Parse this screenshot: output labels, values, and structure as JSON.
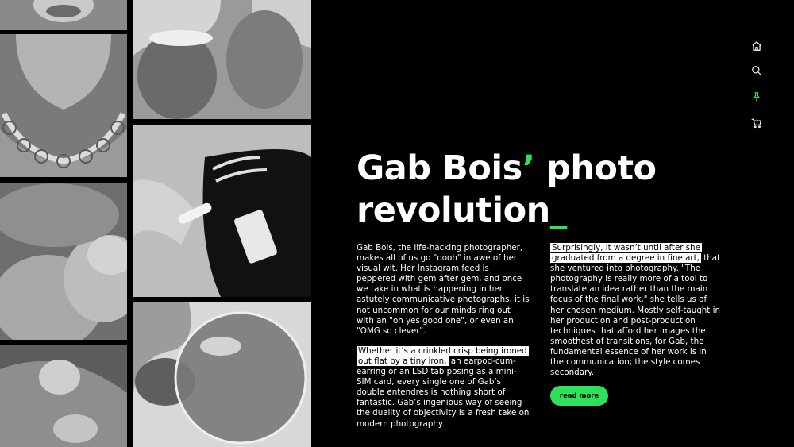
{
  "article": {
    "title_main": "Gab Bois",
    "title_apos": "’",
    "title_rest": " photo revolution",
    "title_cursor": "_",
    "col1": {
      "p1": "Gab Bois, the life-hacking photographer, makes all of us go \"oooh\" in awe of her visual wit. Her Instagram feed is peppered with gem after gem, and once we take in what is happening in her astutely communicative photographs, it is not uncommon for our minds ring out with an \"oh yes good one\", or even an \"OMG so clever\".",
      "p2_highlight": "Whether it’s a crinkled crisp being ironed out flat by a tiny iron,",
      "p2_rest": " an earpod-cum-earring or an LSD tab posing as a mini-SIM card, every single one of Gab’s double entendres is nothing short of fantastic. Gab’s ingenious way of seeing the duality of objectivity is a fresh take on modern photography."
    },
    "col2": {
      "highlight": "Surprisingly, it wasn’t until after she graduated from a degree in fine art,",
      "rest": " that she ventured into photography. \"The photography is really more of a tool to translate an idea rather than the main focus of the final work,\" she tells us of her chosen medium. Mostly self-taught in her production and post-production techniques that afford her images the smoothest of transitions, for Gab, the fundamental essence of her work is in the communication; the style comes secondary."
    },
    "read_more": "read more"
  },
  "nav": {
    "icons": [
      "home-icon",
      "search-icon",
      "pin-icon",
      "cart-icon"
    ],
    "active": "pin-icon"
  },
  "colors": {
    "accent": "#2ee05a",
    "background": "#000000",
    "text": "#ffffff"
  }
}
